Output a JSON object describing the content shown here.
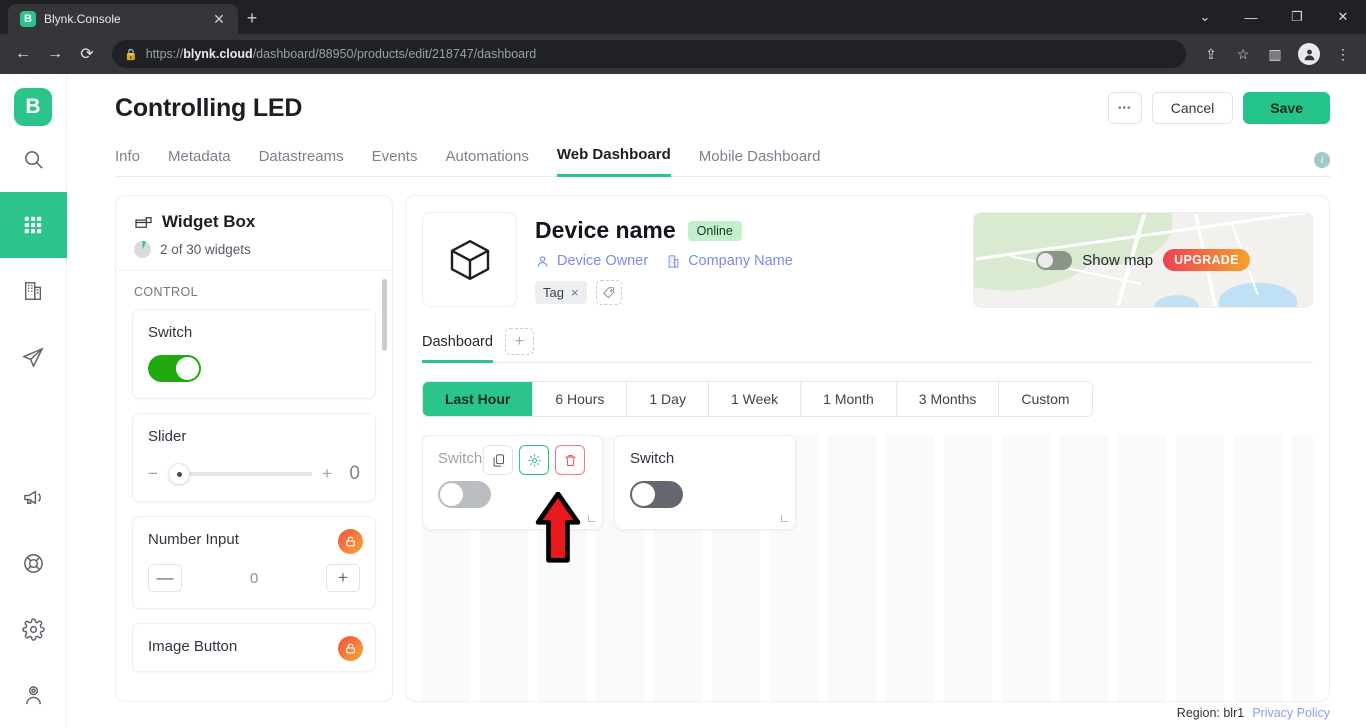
{
  "browser": {
    "tab_title": "Blynk.Console",
    "tab_favicon_letter": "B",
    "url_prefix": "https://",
    "url_domain": "blynk.cloud",
    "url_path": "/dashboard/88950/products/edit/218747/dashboard"
  },
  "rail": {
    "brand_letter": "B",
    "items": [
      {
        "name": "search-icon",
        "label": "Search"
      },
      {
        "name": "devices-grid-icon",
        "label": "Devices"
      },
      {
        "name": "organizations-icon",
        "label": "Organizations"
      },
      {
        "name": "send-icon",
        "label": "Send"
      },
      {
        "name": "announcements-icon",
        "label": "Announcements"
      },
      {
        "name": "support-icon",
        "label": "Support"
      },
      {
        "name": "settings-icon",
        "label": "Settings"
      },
      {
        "name": "user-admin-icon",
        "label": "Account"
      }
    ]
  },
  "header": {
    "title": "Controlling LED",
    "more_label": "•••",
    "cancel_label": "Cancel",
    "save_label": "Save",
    "info_label": "i"
  },
  "tabs": [
    {
      "label": "Info",
      "active": false
    },
    {
      "label": "Metadata",
      "active": false
    },
    {
      "label": "Datastreams",
      "active": false
    },
    {
      "label": "Events",
      "active": false
    },
    {
      "label": "Automations",
      "active": false
    },
    {
      "label": "Web Dashboard",
      "active": true
    },
    {
      "label": "Mobile Dashboard",
      "active": false
    }
  ],
  "widget_box": {
    "title": "Widget Box",
    "count_label": "2 of 30 widgets",
    "section_label": "CONTROL",
    "widgets": [
      {
        "title": "Switch",
        "type": "toggle",
        "state": "on",
        "locked": false
      },
      {
        "title": "Slider",
        "type": "slider",
        "value": "0",
        "locked": false
      },
      {
        "title": "Number Input",
        "type": "number",
        "value": "0",
        "locked": true
      },
      {
        "title": "Image Button",
        "type": "image-button",
        "locked": true
      }
    ]
  },
  "device": {
    "name": "Device name",
    "status": "Online",
    "owner": "Device Owner",
    "company": "Company Name",
    "tag": "Tag",
    "tag_remove": "×"
  },
  "map": {
    "toggle_label": "Show map",
    "upgrade_label": "UPGRADE",
    "enabled": false
  },
  "dashboard": {
    "tab_label": "Dashboard",
    "add_tab_label": "+",
    "ranges": [
      {
        "label": "Last Hour",
        "active": true
      },
      {
        "label": "6 Hours",
        "active": false
      },
      {
        "label": "1 Day",
        "active": false
      },
      {
        "label": "1 Week",
        "active": false
      },
      {
        "label": "1 Month",
        "active": false
      },
      {
        "label": "3 Months",
        "active": false
      },
      {
        "label": "Custom",
        "active": false
      }
    ],
    "widgets": [
      {
        "title": "Switch",
        "toggle": "off-light",
        "hovered": true
      },
      {
        "title": "Switch",
        "toggle": "off-dark",
        "hovered": false
      }
    ],
    "tools": {
      "copy": "copy-icon",
      "settings": "gear-icon",
      "delete": "trash-icon"
    }
  },
  "footer": {
    "region": "Region: blr1",
    "privacy": "Privacy Policy"
  },
  "colors": {
    "accent_green": "#2bc48a",
    "save_green": "#24c48a",
    "toggle_on_green": "#22a90f",
    "online_badge": "#c2f0cd",
    "link_purple": "#7b8af0",
    "upgrade_from": "#ef3f54",
    "upgrade_to": "#f5a32a",
    "annotation_red": "#e8191f"
  }
}
